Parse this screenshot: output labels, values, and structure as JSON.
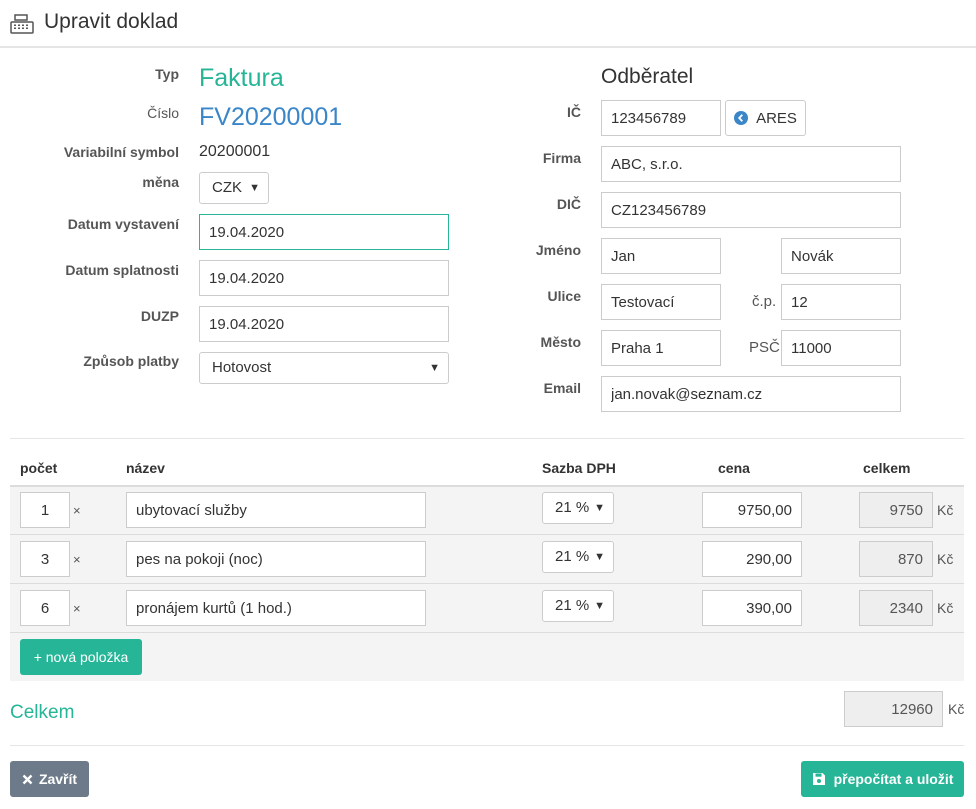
{
  "header": {
    "title": "Upravit doklad",
    "icon": "cash-register-icon"
  },
  "document": {
    "type_label": "Typ",
    "type_value": "Faktura",
    "number_label": "Číslo",
    "number_value": "FV20200001",
    "vs_label": "Variabilní symbol",
    "vs_value": "20200001",
    "currency_label": "měna",
    "currency_value": "CZK",
    "issue_label": "Datum vystavení",
    "issue_value": "19.04.2020",
    "due_label": "Datum splatnosti",
    "due_value": "19.04.2020",
    "duzp_label": "DUZP",
    "duzp_value": "19.04.2020",
    "payment_label": "Způsob platby",
    "payment_value": "Hotovost"
  },
  "customer": {
    "heading": "Odběratel",
    "ic_label": "IČ",
    "ic_value": "123456789",
    "ares_label": "ARES",
    "firm_label": "Firma",
    "firm_value": "ABC, s.r.o.",
    "dic_label": "DIČ",
    "dic_value": "CZ123456789",
    "name_label": "Jméno",
    "first_name": "Jan",
    "last_name": "Novák",
    "street_label": "Ulice",
    "street_value": "Testovací",
    "cp_label": "č.p.",
    "cp_value": "12",
    "city_label": "Město",
    "city_value": "Praha 1",
    "psc_label": "PSČ",
    "psc_value": "11000",
    "email_label": "Email",
    "email_value": "jan.novak@seznam.cz"
  },
  "items": {
    "headers": {
      "count": "počet",
      "name": "název",
      "vat": "Sazba DPH",
      "price": "cena",
      "total": "celkem"
    },
    "times_sign": "×",
    "currency": "Kč",
    "rows": [
      {
        "count": "1",
        "name": "ubytovací služby",
        "vat": "21 %",
        "price": "9750,00",
        "total": "9750"
      },
      {
        "count": "3",
        "name": "pes na pokoji (noc)",
        "vat": "21 %",
        "price": "290,00",
        "total": "870"
      },
      {
        "count": "6",
        "name": "pronájem kurtů (1 hod.)",
        "vat": "21 %",
        "price": "390,00",
        "total": "2340"
      }
    ],
    "add_label": "+ nová položka"
  },
  "summary": {
    "label": "Celkem",
    "value": "12960",
    "currency": "Kč"
  },
  "footer": {
    "close_label": "Zavřít",
    "save_label": "přepočítat a uložit"
  },
  "colors": {
    "accent": "#26b597",
    "link": "#3a86c8",
    "grey_button": "#6c7a89"
  }
}
